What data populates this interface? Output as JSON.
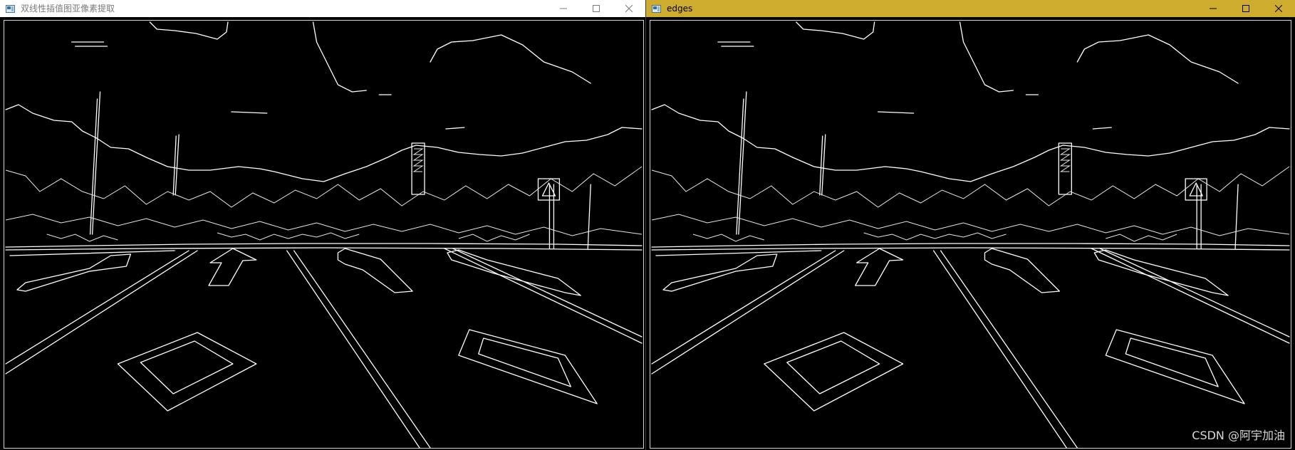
{
  "windows": [
    {
      "id": "left",
      "title": "双线性插值图亚像素提取",
      "active": false
    },
    {
      "id": "right",
      "title": "edges",
      "active": true
    }
  ],
  "colors": {
    "active_titlebar": "#ceac2e",
    "inactive_titlebar": "#ffffff",
    "canvas_background": "#000000",
    "edge_color": "#ffffff"
  },
  "icons": {
    "app": "window-app-icon",
    "minimize": "minimize-icon",
    "maximize": "maximize-icon",
    "close": "close-icon"
  },
  "watermark": "CSDN @阿宇加油"
}
